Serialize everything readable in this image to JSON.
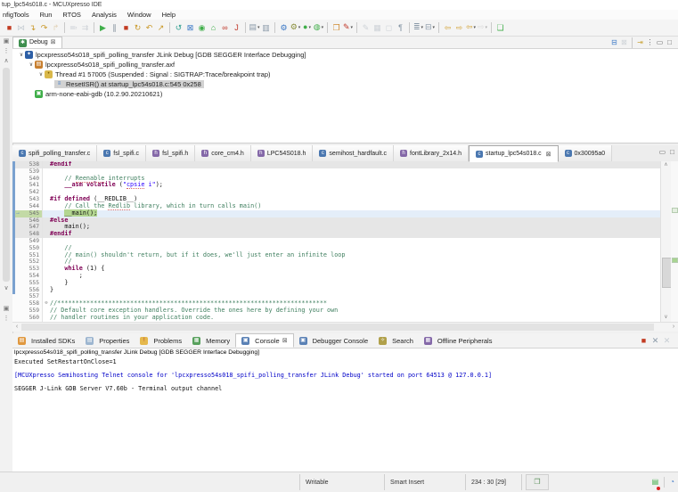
{
  "window": {
    "title": "tup_lpc54s018.c - MCUXpresso IDE"
  },
  "menu_bar": {
    "items": [
      "nfigTools",
      "Run",
      "RTOS",
      "Analysis",
      "Window",
      "Help"
    ]
  },
  "icons": {
    "dropdown": "▾",
    "close": "×",
    "close_boxed": "⊠",
    "chevron": "∨",
    "minimize": "▭",
    "maximize": "□",
    "menu_dots": "⋮",
    "restore": "▣",
    "up": "∧",
    "down": "∨",
    "left": "‹",
    "right": "›",
    "fold_collapse": "⊖",
    "ip_arrow": "→"
  },
  "main_toolbar": {
    "items": [
      {
        "name": "terminate",
        "glyph": "■",
        "color": "#c23b22"
      },
      {
        "name": "skip-all-breakpoints",
        "glyph": "⋈",
        "color": "#8a99a8",
        "dim": true
      },
      {
        "name": "step-into",
        "glyph": "↴",
        "color": "#c99726"
      },
      {
        "name": "step-over",
        "glyph": "↷",
        "color": "#c99726"
      },
      {
        "name": "step-return",
        "glyph": "↱",
        "color": "#c9a76a",
        "dim": true
      },
      {
        "sep": true
      },
      {
        "name": "instruction-stepping",
        "glyph": "≕",
        "color": "#9aa5b0",
        "dim": true
      },
      {
        "name": "move-to-line",
        "glyph": "⇉",
        "color": "#9aa5b0",
        "dim": true
      },
      {
        "sep": true
      },
      {
        "name": "resume",
        "glyph": "▶",
        "color": "#3fae49"
      },
      {
        "name": "suspend",
        "glyph": "∥",
        "color": "#7f8c99"
      },
      {
        "name": "stop",
        "glyph": "■",
        "color": "#c23b22"
      },
      {
        "name": "restart",
        "glyph": "↻",
        "color": "#c99726"
      },
      {
        "name": "reset",
        "glyph": "↶",
        "color": "#c99726"
      },
      {
        "name": "step-next",
        "glyph": "↗",
        "color": "#c99726"
      },
      {
        "sep": true
      },
      {
        "name": "refresh",
        "glyph": "↺",
        "color": "#2e9e8f"
      },
      {
        "name": "terminate-remove",
        "glyph": "⊠",
        "color": "#3b78c6"
      },
      {
        "name": "world",
        "glyph": "◉",
        "color": "#3fae49"
      },
      {
        "name": "home",
        "glyph": "⌂",
        "color": "#3fae49"
      },
      {
        "name": "link",
        "glyph": "∞",
        "color": "#c0392b"
      },
      {
        "name": "jlink",
        "glyph": "J",
        "color": "#c0392b"
      },
      {
        "sep": true
      },
      {
        "name": "layers",
        "glyph": "▤",
        "color": "#8a99a8",
        "drop": true
      },
      {
        "name": "remove-console",
        "glyph": "▥",
        "color": "#8a99a8"
      },
      {
        "sep": true
      },
      {
        "name": "settings",
        "glyph": "⚙",
        "color": "#3b78c6"
      },
      {
        "name": "build",
        "glyph": "⚙",
        "color": "#8a8f3c",
        "drop": true
      },
      {
        "name": "run",
        "glyph": "●",
        "color": "#3fae49",
        "drop": true
      },
      {
        "name": "debug-launch",
        "glyph": "◍",
        "color": "#3fae49",
        "drop": true
      },
      {
        "sep": true
      },
      {
        "name": "open-resource",
        "glyph": "❐",
        "color": "#d08a2e"
      },
      {
        "name": "link-with-editor",
        "glyph": "✎",
        "color": "#c0392b",
        "drop": true
      },
      {
        "sep": true
      },
      {
        "name": "format",
        "glyph": "✎",
        "color": "#9aa5b0",
        "dim": true
      },
      {
        "name": "toggle-mark",
        "glyph": "▦",
        "color": "#9aa5b0",
        "dim": true
      },
      {
        "name": "block-selection",
        "glyph": "◻",
        "color": "#9aa5b0",
        "dim": true
      },
      {
        "name": "show-whitespace",
        "glyph": "¶",
        "color": "#8a99a8"
      },
      {
        "sep": true
      },
      {
        "name": "numbered-list",
        "glyph": "≣",
        "color": "#8a99a8",
        "drop": true
      },
      {
        "name": "hierarchy",
        "glyph": "⊟",
        "color": "#8a99a8",
        "drop": true
      },
      {
        "sep": true
      },
      {
        "name": "back",
        "glyph": "⇦",
        "color": "#d3a43a"
      },
      {
        "name": "forward",
        "glyph": "⇨",
        "color": "#d3a43a"
      },
      {
        "name": "back-history",
        "glyph": "⇦",
        "color": "#d3a43a",
        "drop": true
      },
      {
        "name": "forward-history",
        "glyph": "⇨",
        "color": "#b9b9b9",
        "drop": true,
        "dim": true
      },
      {
        "sep": true
      },
      {
        "name": "last-edit-location",
        "glyph": "❏",
        "color": "#3fae49"
      }
    ]
  },
  "debug_view": {
    "tab_label": "Debug",
    "toolbar": [
      {
        "name": "collapse-all",
        "glyph": "⊟",
        "color": "#3b78c6"
      },
      {
        "name": "remove-all-terminated",
        "glyph": "⊠",
        "color": "#9aa5b0",
        "dim": true
      },
      {
        "sep": true
      },
      {
        "name": "focus-on-stack",
        "glyph": "⇥",
        "color": "#caa53d"
      },
      {
        "name": "view-menu",
        "glyph": "⋮",
        "color": "#666666"
      },
      {
        "name": "minimize-view",
        "glyph": "▭",
        "color": "#666666"
      },
      {
        "name": "maximize-view",
        "glyph": "□",
        "color": "#666666"
      }
    ],
    "tree": [
      {
        "name": "debug-session",
        "level": 0,
        "expanded": true,
        "ic_glyph": "✦",
        "ic_bg": "#2d5fa6",
        "ic_fg": "#ffffff",
        "label": "lpcxpresso54s018_spifi_polling_transfer JLink Debug [GDB SEGGER Interface Debugging]"
      },
      {
        "name": "debug-program",
        "level": 1,
        "expanded": true,
        "ic_glyph": "▤",
        "ic_bg": "#c87f2f",
        "ic_fg": "#ffffff",
        "label": "lpcxpresso54s018_spifi_polling_transfer.axf"
      },
      {
        "name": "debug-thread",
        "level": 2,
        "expanded": true,
        "ic_glyph": "•",
        "ic_bg": "#d9b84a",
        "ic_fg": "#7a5a00",
        "label": "Thread #1 57005 (Suspended : Signal : SIGTRAP:Trace/breakpoint trap)"
      },
      {
        "name": "stack-frame",
        "level": 3,
        "expanded": false,
        "selected": true,
        "ic_glyph": "≡",
        "ic_bg": "transparent",
        "ic_fg": "#3b78c6",
        "label": "ResetISR() at startup_lpc54s018.c:545 0x258"
      },
      {
        "name": "gdb-process",
        "level": 1,
        "expanded": false,
        "ic_glyph": "▣",
        "ic_bg": "#3fae49",
        "ic_fg": "#ffffff",
        "label": "arm-none-eabi-gdb (10.2.90.20210621)"
      }
    ]
  },
  "editor": {
    "tabs": [
      {
        "label": "spifi_polling_transfer.c",
        "ic": "c"
      },
      {
        "label": "fsl_spifi.c",
        "ic": "c"
      },
      {
        "label": "fsl_spifi.h",
        "ic": "h"
      },
      {
        "label": "core_cm4.h",
        "ic": "h"
      },
      {
        "label": "LPC54S018.h",
        "ic": "h"
      },
      {
        "label": "semihost_hardfault.c",
        "ic": "c"
      },
      {
        "label": "fontLibrary_2x14.h",
        "ic": "h"
      },
      {
        "label": "startup_lpc54s018.c",
        "ic": "c",
        "active": true
      },
      {
        "label": "0x30095a0",
        "ic": "c"
      }
    ],
    "lines": [
      {
        "n": 538,
        "bg": "inactive",
        "tokens": [
          [
            "pp",
            "#endif"
          ]
        ]
      },
      {
        "n": 539,
        "tokens": []
      },
      {
        "n": 540,
        "tokens": [
          [
            "plain",
            "    "
          ],
          [
            "com",
            "// "
          ],
          [
            "com-u",
            "Reenable"
          ],
          [
            "com",
            " interrupts"
          ]
        ]
      },
      {
        "n": 541,
        "tokens": [
          [
            "plain",
            "    "
          ],
          [
            "kw",
            "__asm"
          ],
          [
            "plain",
            " "
          ],
          [
            "kw",
            "volatile"
          ],
          [
            "plain",
            " ("
          ],
          [
            "str",
            "\""
          ],
          [
            "str-u",
            "cpsie"
          ],
          [
            "str",
            " i\""
          ],
          [
            "plain",
            ");"
          ]
        ]
      },
      {
        "n": 542,
        "tokens": []
      },
      {
        "n": 543,
        "tokens": [
          [
            "pp",
            "#if defined"
          ],
          [
            "plain",
            " (__REDLIB__)"
          ]
        ]
      },
      {
        "n": 544,
        "tokens": [
          [
            "plain",
            "    "
          ],
          [
            "com",
            "// Call the "
          ],
          [
            "com-u",
            "Redlib"
          ],
          [
            "com",
            " library, which in turn calls main()"
          ]
        ]
      },
      {
        "n": 545,
        "bg": "current",
        "tokens": [
          [
            "plain",
            "    "
          ],
          [
            "cur",
            "__main();"
          ]
        ]
      },
      {
        "n": 546,
        "bg": "inactive",
        "tokens": [
          [
            "pp",
            "#else"
          ]
        ]
      },
      {
        "n": 547,
        "bg": "inactive",
        "tokens": [
          [
            "plain",
            "    main();"
          ]
        ]
      },
      {
        "n": 548,
        "bg": "inactive",
        "tokens": [
          [
            "pp",
            "#endif"
          ]
        ]
      },
      {
        "n": 549,
        "tokens": []
      },
      {
        "n": 550,
        "tokens": [
          [
            "plain",
            "    "
          ],
          [
            "com",
            "//"
          ]
        ]
      },
      {
        "n": 551,
        "tokens": [
          [
            "plain",
            "    "
          ],
          [
            "com",
            "// main() shouldn't return, but if it does, we'll just enter an infinite loop"
          ]
        ]
      },
      {
        "n": 552,
        "tokens": [
          [
            "plain",
            "    "
          ],
          [
            "com",
            "//"
          ]
        ]
      },
      {
        "n": 553,
        "tokens": [
          [
            "plain",
            "    "
          ],
          [
            "kw",
            "while"
          ],
          [
            "plain",
            " (1) {"
          ]
        ]
      },
      {
        "n": 554,
        "tokens": [
          [
            "plain",
            "        ;"
          ]
        ]
      },
      {
        "n": 555,
        "tokens": [
          [
            "plain",
            "    }"
          ]
        ]
      },
      {
        "n": 556,
        "tokens": [
          [
            "plain",
            "}"
          ]
        ]
      },
      {
        "n": 557,
        "tokens": []
      },
      {
        "n": 558,
        "fold": true,
        "tokens": [
          [
            "com",
            "//**************************************************************************"
          ]
        ]
      },
      {
        "n": 559,
        "tokens": [
          [
            "com",
            "// Default core exception handlers. Override the ones here by defining your own"
          ]
        ]
      },
      {
        "n": 560,
        "tokens": [
          [
            "com",
            "// handler routines in your application code."
          ]
        ]
      }
    ]
  },
  "bottom_panel": {
    "tabs": [
      {
        "label": "Installed SDKs",
        "ic_glyph": "▤",
        "ic_bg": "#e0983f",
        "ic_fg": "#ffffff"
      },
      {
        "label": "Properties",
        "ic_glyph": "▤",
        "ic_bg": "#9db6d0",
        "ic_fg": "#ffffff"
      },
      {
        "label": "Problems",
        "ic_glyph": "!",
        "ic_bg": "#e5b84c",
        "ic_fg": "#a33"
      },
      {
        "label": "Memory",
        "ic_glyph": "▦",
        "ic_bg": "#57a05c",
        "ic_fg": "#ffffff"
      },
      {
        "label": "Console",
        "ic_glyph": "▣",
        "ic_bg": "#5a81b5",
        "ic_fg": "#ffffff",
        "active": true
      },
      {
        "label": "Debugger Console",
        "ic_glyph": "▣",
        "ic_bg": "#5a81b5",
        "ic_fg": "#ffffff"
      },
      {
        "label": "Search",
        "ic_glyph": "✧",
        "ic_bg": "#b0a04a",
        "ic_fg": "#ffffff"
      },
      {
        "label": "Offline Peripherals",
        "ic_glyph": "▦",
        "ic_bg": "#8468a8",
        "ic_fg": "#ffffff"
      }
    ],
    "toolbar": [
      {
        "name": "terminate-console",
        "glyph": "■",
        "color": "#c23b22"
      },
      {
        "name": "remove-launch",
        "glyph": "✕",
        "color": "#8a99a8"
      },
      {
        "name": "remove-all-launches",
        "glyph": "✕",
        "color": "#8a99a8",
        "dim": true
      }
    ],
    "console_title": "lpcxpresso54s018_spifi_polling_transfer JLink Debug [GDB SEGGER Interface Debugging]",
    "console_lines": [
      {
        "text": "Executed SetRestartOnClose=1",
        "color": "default"
      },
      {
        "text": "",
        "color": "default"
      },
      {
        "text": "[MCUXpresso Semihosting Telnet console for 'lpcxpresso54s018_spifi_polling_transfer JLink Debug' started on port 64513 @ 127.0.0.1]",
        "color": "blue"
      },
      {
        "text": "",
        "color": "default"
      },
      {
        "text": "SEGGER J-Link GDB Server V7.60b - Terminal output channel",
        "color": "default"
      }
    ]
  },
  "status_bar": {
    "writable": "Writable",
    "insert_mode": "Smart Insert",
    "caret_position": "234 : 30 [29]",
    "icons": [
      {
        "name": "open-console",
        "glyph": "❐",
        "color": "#5a8f5a"
      },
      {
        "name": "sdk-stack",
        "glyph": "▤",
        "color": "#3fae49",
        "badge": true
      },
      {
        "name": "progress",
        "glyph": "◔",
        "color": "#3b78c6"
      }
    ]
  }
}
